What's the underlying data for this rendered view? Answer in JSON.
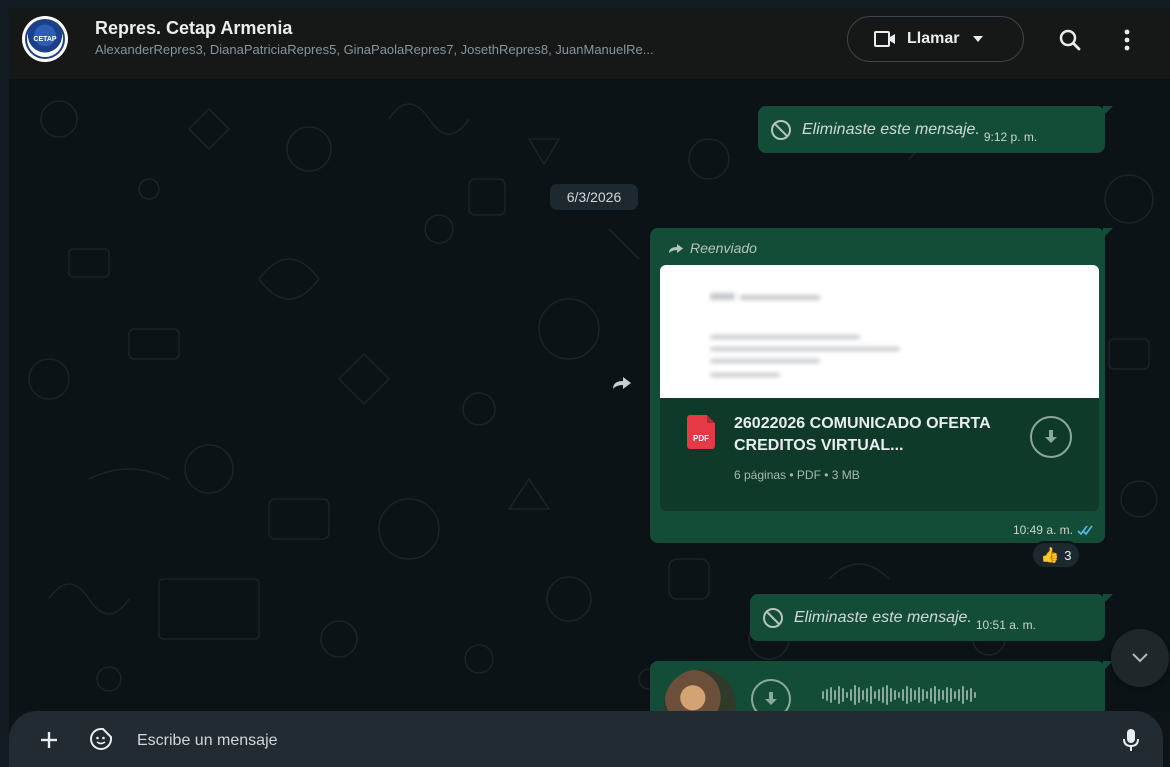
{
  "header": {
    "title": "Repres. Cetap Armenia",
    "members": "AlexanderRepres3, DianaPatriciaRepres5, GinaPaolaRepres7, JosethRepres8, JuanManuelRe...",
    "call_label": "Llamar",
    "icons": [
      "group-avatar",
      "video-icon",
      "chevron-down-icon",
      "search-icon",
      "more-vert-icon"
    ]
  },
  "messages": {
    "deleted_1": {
      "text": "Eliminaste este mensaje.",
      "time": "9:12 p. m."
    },
    "date_chip": "6/3/2026",
    "document": {
      "forwarded_label": "Reenviado",
      "name": "26022026 COMUNICADO OFERTA CREDITOS VIRTUAL...",
      "meta": "6 páginas • PDF • 3 MB",
      "file_type": "PDF",
      "time": "10:49 a. m.",
      "status": "read",
      "reaction_emoji": "👍",
      "reaction_count": "3"
    },
    "deleted_2": {
      "text": "Eliminaste este mensaje.",
      "time": "10:51 a. m."
    },
    "audio": {
      "status": "not-downloaded"
    }
  },
  "input": {
    "placeholder": "Escribe un mensaje"
  },
  "colors": {
    "bubble_out": "#144d37",
    "background": "#0c1317",
    "header": "#161717",
    "read_ticks": "#53bdeb"
  }
}
